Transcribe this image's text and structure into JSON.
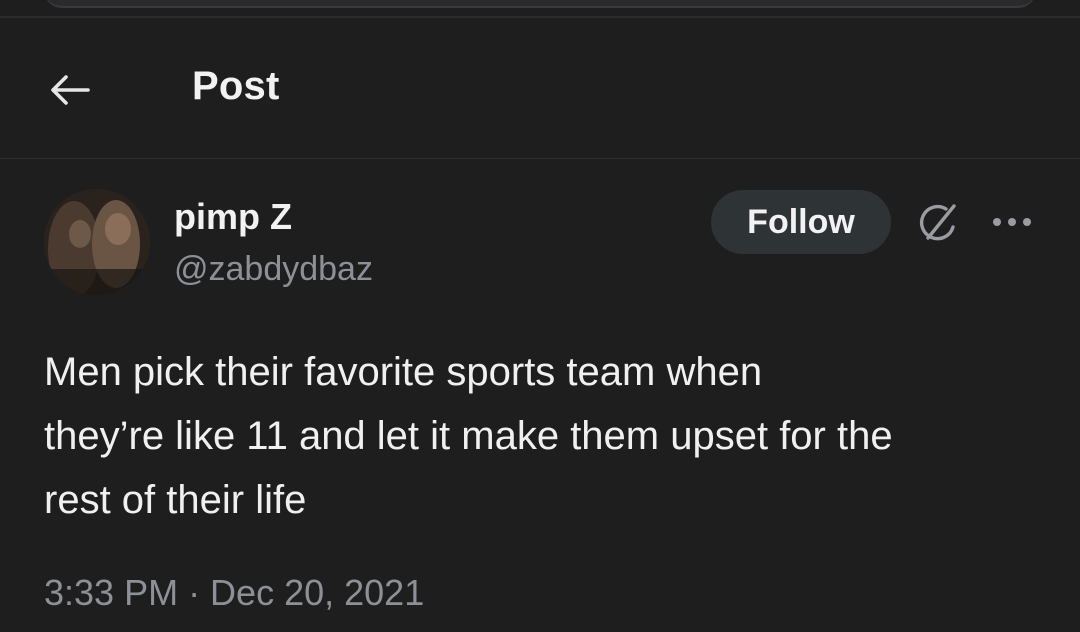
{
  "header": {
    "title": "Post",
    "back_icon": "arrow-left-icon"
  },
  "post": {
    "author_name": "pimp Z",
    "author_handle": "@zabdydbaz",
    "follow_label": "Follow",
    "grok_icon": "grok-icon",
    "more_icon": "more-horizontal-icon",
    "text": "Men pick their favorite sports team when\nthey’re like 11 and let it make them upset for the\nrest of their life",
    "timestamp": "3:33 PM · Dec 20, 2021"
  },
  "colors": {
    "background": "#1e1e1f",
    "text_primary": "#f2f2f2",
    "text_secondary": "#8d9096",
    "follow_button_bg": "#2e3336"
  }
}
